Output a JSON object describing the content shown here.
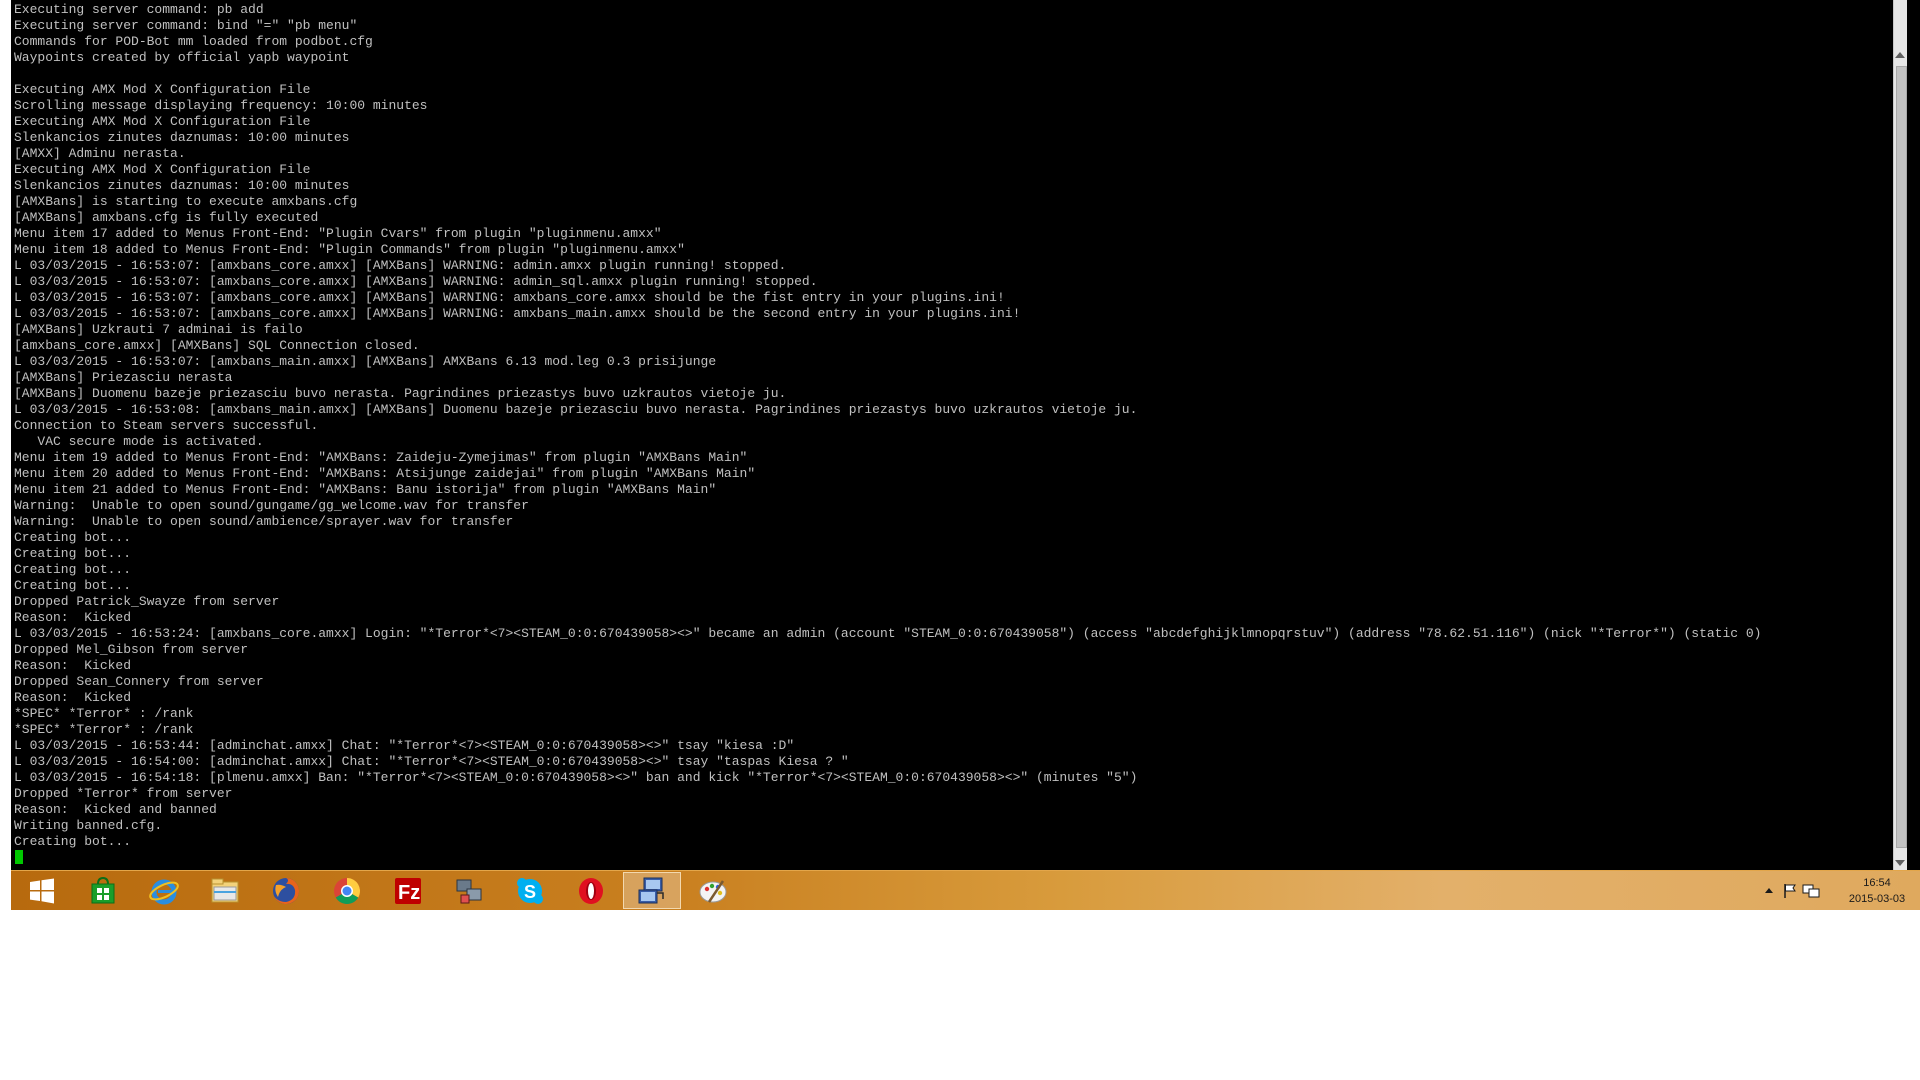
{
  "console": {
    "lines": [
      "Executing server command: pb add",
      "Executing server command: bind \"=\" \"pb menu\"",
      "Commands for POD-Bot mm loaded from podbot.cfg",
      "Waypoints created by official yapb waypoint",
      "",
      "Executing AMX Mod X Configuration File",
      "Scrolling message displaying frequency: 10:00 minutes",
      "Executing AMX Mod X Configuration File",
      "Slenkancios zinutes daznumas: 10:00 minutes",
      "[AMXX] Adminu nerasta.",
      "Executing AMX Mod X Configuration File",
      "Slenkancios zinutes daznumas: 10:00 minutes",
      "[AMXBans] is starting to execute amxbans.cfg",
      "[AMXBans] amxbans.cfg is fully executed",
      "Menu item 17 added to Menus Front-End: \"Plugin Cvars\" from plugin \"pluginmenu.amxx\"",
      "Menu item 18 added to Menus Front-End: \"Plugin Commands\" from plugin \"pluginmenu.amxx\"",
      "L 03/03/2015 - 16:53:07: [amxbans_core.amxx] [AMXBans] WARNING: admin.amxx plugin running! stopped.",
      "L 03/03/2015 - 16:53:07: [amxbans_core.amxx] [AMXBans] WARNING: admin_sql.amxx plugin running! stopped.",
      "L 03/03/2015 - 16:53:07: [amxbans_core.amxx] [AMXBans] WARNING: amxbans_core.amxx should be the fist entry in your plugins.ini!",
      "L 03/03/2015 - 16:53:07: [amxbans_core.amxx] [AMXBans] WARNING: amxbans_main.amxx should be the second entry in your plugins.ini!",
      "[AMXBans] Uzkrauti 7 adminai is failo",
      "[amxbans_core.amxx] [AMXBans] SQL Connection closed.",
      "L 03/03/2015 - 16:53:07: [amxbans_main.amxx] [AMXBans] AMXBans 6.13 mod.leg 0.3 prisijunge",
      "[AMXBans] Priezasciu nerasta",
      "[AMXBans] Duomenu bazeje priezasciu buvo nerasta. Pagrindines priezastys buvo uzkrautos vietoje ju.",
      "L 03/03/2015 - 16:53:08: [amxbans_main.amxx] [AMXBans] Duomenu bazeje priezasciu buvo nerasta. Pagrindines priezastys buvo uzkrautos vietoje ju.",
      "Connection to Steam servers successful.",
      "   VAC secure mode is activated.",
      "Menu item 19 added to Menus Front-End: \"AMXBans: Zaideju-Zymejimas\" from plugin \"AMXBans Main\"",
      "Menu item 20 added to Menus Front-End: \"AMXBans: Atsijunge zaidejai\" from plugin \"AMXBans Main\"",
      "Menu item 21 added to Menus Front-End: \"AMXBans: Banu istorija\" from plugin \"AMXBans Main\"",
      "Warning:  Unable to open sound/gungame/gg_welcome.wav for transfer",
      "Warning:  Unable to open sound/ambience/sprayer.wav for transfer",
      "Creating bot...",
      "Creating bot...",
      "Creating bot...",
      "Creating bot...",
      "Dropped Patrick_Swayze from server",
      "Reason:  Kicked",
      "L 03/03/2015 - 16:53:24: [amxbans_core.amxx] Login: \"*Terror*<7><STEAM_0:0:670439058><>\" became an admin (account \"STEAM_0:0:670439058\") (access \"abcdefghijklmnopqrstuv\") (address \"78.62.51.116\") (nick \"*Terror*\") (static 0)",
      "Dropped Mel_Gibson from server",
      "Reason:  Kicked",
      "Dropped Sean_Connery from server",
      "Reason:  Kicked",
      "*SPEC* *Terror* : /rank",
      "*SPEC* *Terror* : /rank",
      "L 03/03/2015 - 16:53:44: [adminchat.amxx] Chat: \"*Terror*<7><STEAM_0:0:670439058><>\" tsay \"kiesa :D\"",
      "L 03/03/2015 - 16:54:00: [adminchat.amxx] Chat: \"*Terror*<7><STEAM_0:0:670439058><>\" tsay \"taspas Kiesa ? \"",
      "L 03/03/2015 - 16:54:18: [plmenu.amxx] Ban: \"*Terror*<7><STEAM_0:0:670439058><>\" ban and kick \"*Terror*<7><STEAM_0:0:670439058><>\" (minutes \"5\")",
      "Dropped *Terror* from server",
      "Reason:  Kicked and banned",
      "Writing banned.cfg.",
      "Creating bot..."
    ],
    "text_color": "#c0c0c0",
    "cursor_color": "#00c800"
  },
  "taskbar": {
    "items": [
      {
        "name": "start-button",
        "icon": "windows-logo-icon",
        "active": false
      },
      {
        "name": "taskbar-store",
        "icon": "store-icon",
        "active": false
      },
      {
        "name": "taskbar-internet-explorer",
        "icon": "internet-explorer-icon",
        "active": false
      },
      {
        "name": "taskbar-file-explorer",
        "icon": "file-explorer-icon",
        "active": false
      },
      {
        "name": "taskbar-firefox",
        "icon": "firefox-icon",
        "active": false
      },
      {
        "name": "taskbar-chrome",
        "icon": "chrome-icon",
        "active": false
      },
      {
        "name": "taskbar-filezilla",
        "icon": "filezilla-icon",
        "active": false
      },
      {
        "name": "taskbar-network-tool",
        "icon": "network-tool-icon",
        "active": false
      },
      {
        "name": "taskbar-skype",
        "icon": "skype-icon",
        "active": false
      },
      {
        "name": "taskbar-opera",
        "icon": "opera-icon",
        "active": false
      },
      {
        "name": "taskbar-server-console",
        "icon": "server-console-icon",
        "active": true
      },
      {
        "name": "taskbar-paint",
        "icon": "paint-icon",
        "active": false
      }
    ],
    "tray": {
      "icons": [
        "show-hidden-icons-arrow-icon",
        "action-center-flag-icon",
        "network-icon"
      ],
      "time": "16:54",
      "date": "2015-03-03"
    },
    "accent": "#c98020"
  }
}
